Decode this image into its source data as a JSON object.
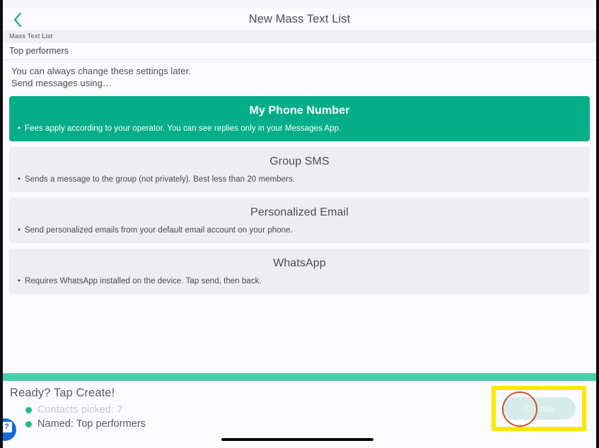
{
  "status_bar": {
    "left": "",
    "right": ""
  },
  "header": {
    "title": "New Mass Text List",
    "back_icon": "chevron-left-icon"
  },
  "name_field": {
    "label": "Mass Text List",
    "value": "Top performers",
    "placeholder": "Mass Text List"
  },
  "helper": {
    "line1": "You can always change these settings later.",
    "line2": "Send messages using…"
  },
  "options": [
    {
      "title": "My Phone Number",
      "description": "Fees apply according to your operator. You can see replies only in your Messages App.",
      "selected": true
    },
    {
      "title": "Group SMS",
      "description": "Sends a message to the group (not privately). Best less than 20 members.",
      "selected": false
    },
    {
      "title": "Personalized Email",
      "description": "Send personalized emails from your default email account on your phone.",
      "selected": false
    },
    {
      "title": "WhatsApp",
      "description": "Requires WhatsApp installed on the device. Tap send, then back.",
      "selected": false
    }
  ],
  "footer": {
    "heading": "Ready? Tap Create!",
    "items": [
      {
        "text": "Contacts picked: 7",
        "state": "dim"
      },
      {
        "text": "Named: Top performers",
        "state": "live"
      }
    ],
    "create_label": "Create",
    "help_label": "?"
  },
  "colors": {
    "accent_green": "#05ae89",
    "mint_bar": "#4ccdae",
    "bullet_green": "#1fbf84",
    "annotation_yellow": "#ffe800",
    "click_ring": "#c8542c",
    "help_blue": "#1769d8",
    "card_grey": "#eeeef2",
    "create_disabled": "#d7ecea"
  }
}
